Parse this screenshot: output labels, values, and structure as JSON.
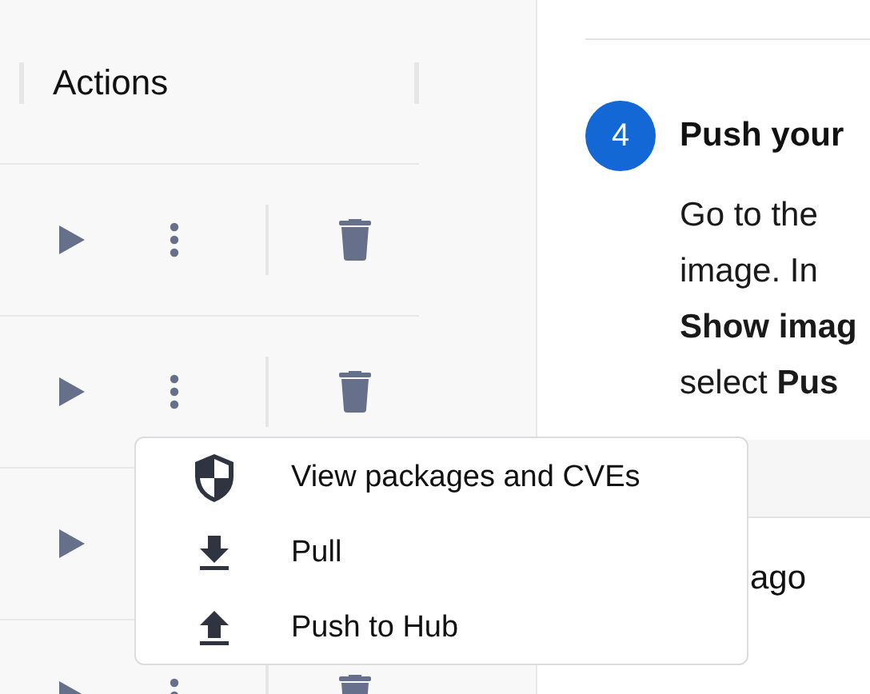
{
  "table": {
    "header": "Actions"
  },
  "step": {
    "number": "4",
    "title": "Push your",
    "lines": [
      "Go to the",
      "image. In",
      "**Show imag**",
      "select **Pus**"
    ]
  },
  "inner_table": {
    "cell": "ago"
  },
  "menu": {
    "items": [
      {
        "kind": "shield",
        "label": "View packages and CVEs"
      },
      {
        "kind": "download",
        "label": "Pull"
      },
      {
        "kind": "upload",
        "label": "Push to Hub"
      }
    ]
  }
}
